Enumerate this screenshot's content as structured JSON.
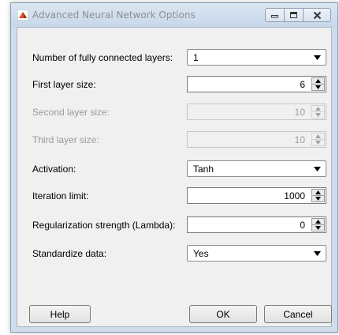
{
  "window": {
    "title": "Advanced Neural Network Options",
    "controls": [
      "minimize-icon",
      "maximize-icon",
      "close-icon"
    ]
  },
  "fields": {
    "num_layers": {
      "label": "Number of fully connected layers:",
      "value": "1"
    },
    "first_layer_size": {
      "label": "First layer size:",
      "value": "6"
    },
    "second_layer_size": {
      "label": "Second layer size:",
      "value": "10"
    },
    "third_layer_size": {
      "label": "Third layer size:",
      "value": "10"
    },
    "activation": {
      "label": "Activation:",
      "value": "Tanh"
    },
    "iteration_limit": {
      "label": "Iteration limit:",
      "value": "1000"
    },
    "lambda": {
      "label": "Regularization strength (Lambda):",
      "value": "0"
    },
    "standardize": {
      "label": "Standardize data:",
      "value": "Yes"
    }
  },
  "buttons": {
    "help": "Help",
    "ok": "OK",
    "cancel": "Cancel"
  },
  "colors": {
    "title_bar": "#cfdcec",
    "panel": "#f0f0f0",
    "disabled_text": "#9a9a9a"
  }
}
